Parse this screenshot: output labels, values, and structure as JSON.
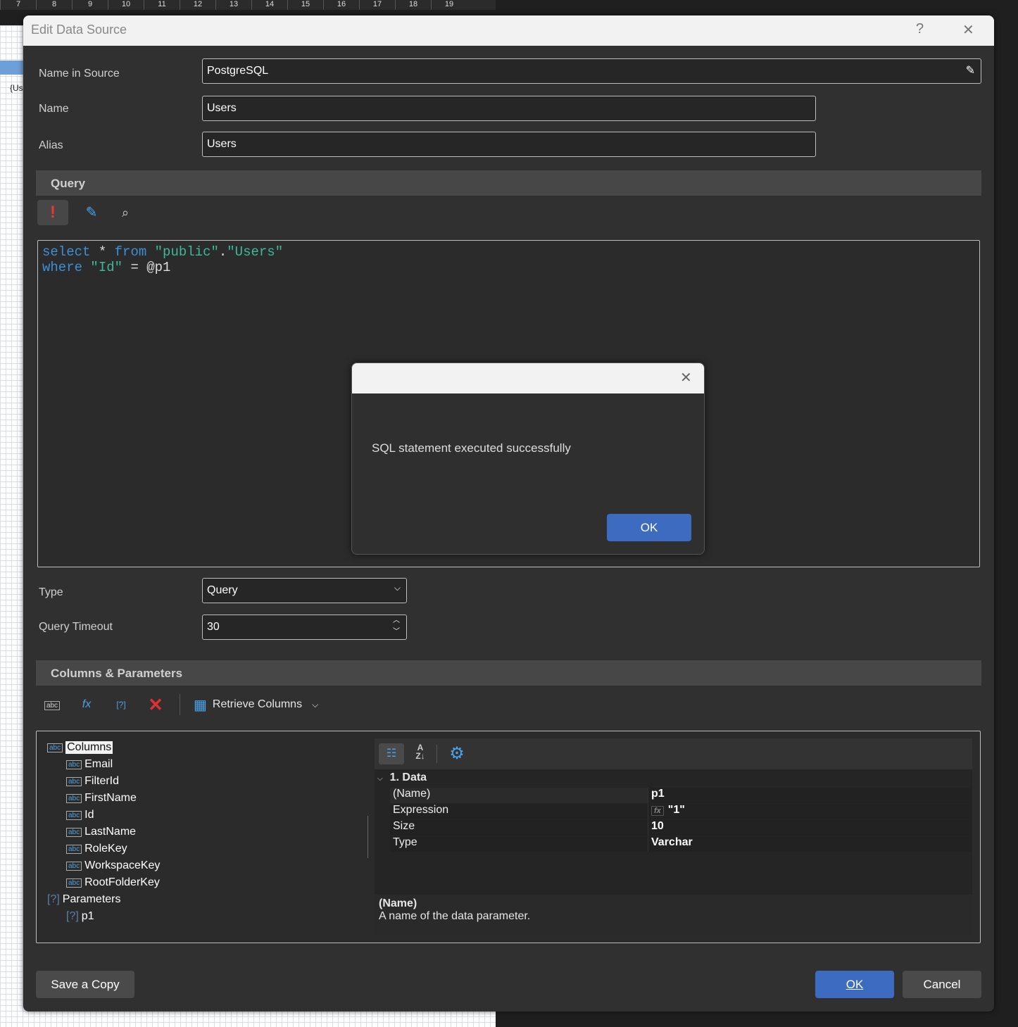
{
  "ruler": [
    "7",
    "8",
    "9",
    "10",
    "11",
    "12",
    "13",
    "14",
    "15",
    "16",
    "17",
    "18",
    "19"
  ],
  "background": {
    "page_text": "{Us"
  },
  "dialog": {
    "title": "Edit Data Source",
    "help": "?",
    "close": "✕",
    "fields": {
      "name_in_source_label": "Name in Source",
      "name_in_source": "PostgreSQL",
      "name_label": "Name",
      "name": "Users",
      "alias_label": "Alias",
      "alias": "Users"
    },
    "query_section": "Query",
    "sql": {
      "line1": [
        "select",
        "*",
        "from",
        "\"public\"",
        ".",
        "\"Users\""
      ],
      "line2": [
        "where",
        "\"Id\"",
        "=",
        "@p1"
      ]
    },
    "type_label": "Type",
    "type": "Query",
    "timeout_label": "Query Timeout",
    "timeout": "30",
    "columns_section": "Columns & Parameters",
    "retrieve_columns": "Retrieve Columns",
    "tree": {
      "columns_label": "Columns",
      "columns": [
        "Email",
        "FilterId",
        "FirstName",
        "Id",
        "LastName",
        "RoleKey",
        "WorkspaceKey",
        "RootFolderKey"
      ],
      "parameters_label": "Parameters",
      "parameters": [
        "p1"
      ],
      "abc": "abc",
      "q": "[?]"
    },
    "props": {
      "category": "1. Data",
      "rows": [
        {
          "k": "(Name)",
          "v": "p1"
        },
        {
          "k": "Expression",
          "v": "\"1\""
        },
        {
          "k": "Size",
          "v": "10"
        },
        {
          "k": "Type",
          "v": "Varchar"
        }
      ],
      "desc_title": "(Name)",
      "desc": "A name of the data parameter."
    },
    "save_copy": "Save a Copy",
    "ok": "OK",
    "cancel": "Cancel"
  },
  "message": {
    "text": "SQL statement executed successfully",
    "ok": "OK",
    "close": "✕"
  },
  "colors": {
    "accent": "#3d6bbf",
    "keyword": "#3d8fd6",
    "string": "#3db89a",
    "delete": "#e03030"
  }
}
